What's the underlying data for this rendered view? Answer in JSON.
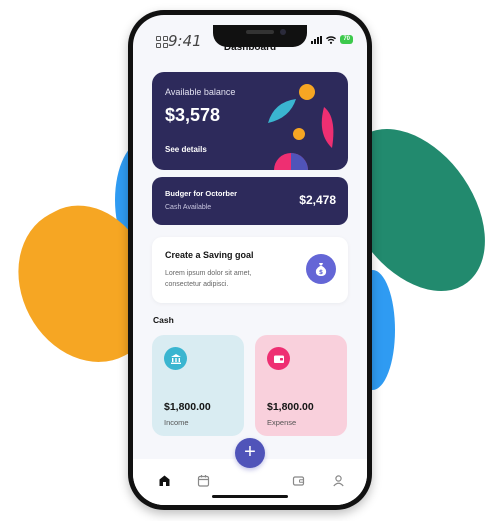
{
  "status_bar": {
    "time": "9:41",
    "battery": "70"
  },
  "header": {
    "title": "Dashboard"
  },
  "balance_card": {
    "label": "Available balance",
    "amount": "$3,578",
    "link": "See details"
  },
  "budget_card": {
    "title": "Budger for Octorber",
    "subtitle": "Cash Available",
    "amount": "$2,478"
  },
  "goal_card": {
    "title": "Create a Saving goal",
    "text": "Lorem ipsum dolor sit amet, consectetur adipisci.",
    "icon": "money-bag-icon"
  },
  "cash_section": {
    "label": "Cash",
    "cards": [
      {
        "amount": "$1,800.00",
        "type": "Income",
        "icon": "bank-icon"
      },
      {
        "amount": "$1,800.00",
        "type": "Expense",
        "icon": "wallet-icon"
      }
    ]
  },
  "tab_bar": {
    "fab_label": "+",
    "tabs": [
      "home-icon",
      "calendar-icon",
      "wallet-icon",
      "profile-icon"
    ]
  },
  "colors": {
    "card_dark": "#2d2a5b",
    "income_bg": "#d9ecf2",
    "expense_bg": "#f9d0dc",
    "accent": "#5054b9",
    "income_icon": "#3ab5d0",
    "expense_icon": "#ee2f72",
    "blob_blue": "#2f9bf2",
    "blob_orange": "#f6a623",
    "blob_green": "#228a6e"
  }
}
